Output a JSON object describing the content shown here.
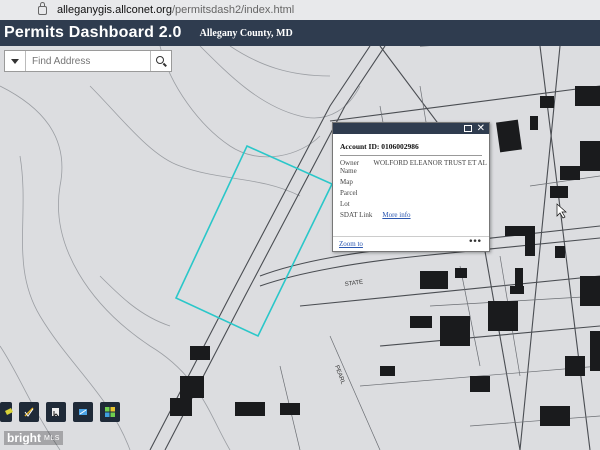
{
  "browser": {
    "url_host": "alleganygis.allconet.org",
    "url_path": "/permitsdash2/index.html"
  },
  "header": {
    "title": "Permits Dashboard 2.0",
    "county": "Allegany County, MD"
  },
  "search": {
    "placeholder": "Find Address"
  },
  "popup": {
    "account_label": "Account ID:",
    "account_id": "0106002986",
    "fields": [
      {
        "label": "Owner Name",
        "value": "WOLFORD ELEANOR TRUST ET AL"
      },
      {
        "label": "Map",
        "value": ""
      },
      {
        "label": "Parcel",
        "value": ""
      },
      {
        "label": "Lot",
        "value": ""
      },
      {
        "label": "SDAT Link",
        "value": "More info"
      }
    ],
    "zoom_label": "Zoom to",
    "menu_glyph": "•••"
  },
  "map": {
    "street_labels": [
      "STATE",
      "PEARL"
    ],
    "highlight_color": "#2ac7c9"
  },
  "toolbar": {
    "icons": [
      "layers-icon",
      "edit-icon",
      "select-icon",
      "measure-icon",
      "basemap-grid-icon"
    ]
  },
  "watermark": {
    "brand": "bright",
    "suffix": "MLS"
  }
}
